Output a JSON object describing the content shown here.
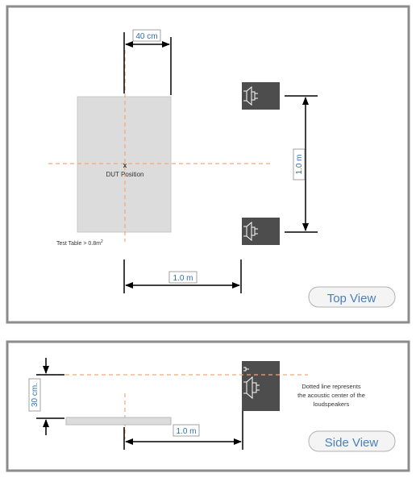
{
  "top_view": {
    "dim_40cm": "40 cm",
    "dut_marker": "x",
    "dut_label": "DUT Position",
    "table_label": "Test Table > 0.8m",
    "table_label_sup": "2",
    "dim_vertical": "1.0 m",
    "dim_horizontal": "1.0 m",
    "view_button": "Top View"
  },
  "side_view": {
    "dim_height": "30 cm.",
    "dim_horizontal": "1.0 m",
    "note_line1": "Dotted line represents",
    "note_line2": "the acoustic center of the",
    "note_line3": "loudspeakers",
    "view_button": "Side View"
  },
  "colors": {
    "panel_border": "#8c8c8c",
    "speaker_box": "#4d4d4d",
    "table_fill": "#dcdcdc",
    "dashed_line": "#f4a677",
    "dim_label": "#2f6fb5",
    "button_text": "#4a7fb8"
  },
  "icons": {
    "speaker": "speaker-icon",
    "arrow": "arrow-icon"
  }
}
